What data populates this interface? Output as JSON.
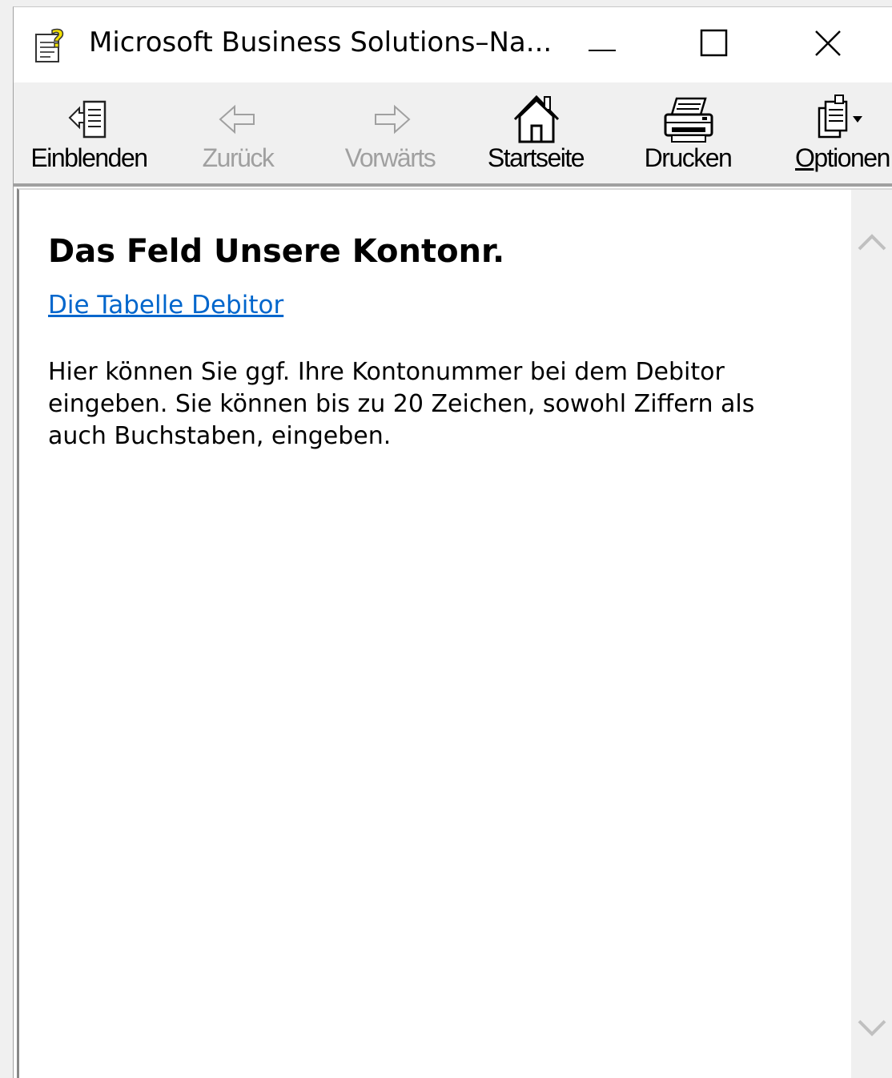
{
  "window": {
    "title": "Microsoft Business Solutions–Na..."
  },
  "toolbar": {
    "items": [
      {
        "label": "Einblenden",
        "icon": "show-pane-icon",
        "enabled": true
      },
      {
        "label": "Zurück",
        "icon": "back-arrow-icon",
        "enabled": false
      },
      {
        "label": "Vorwärts",
        "icon": "forward-arrow-icon",
        "enabled": false
      },
      {
        "label": "Startseite",
        "icon": "home-icon",
        "enabled": true
      },
      {
        "label": "Drucken",
        "icon": "printer-icon",
        "enabled": true
      },
      {
        "label": "Optionen",
        "icon": "options-icon",
        "enabled": true
      }
    ]
  },
  "content": {
    "heading": "Das Feld Unsere Kontonr.",
    "link": "Die Tabelle Debitor",
    "body": "Hier können Sie ggf. Ihre Kontonummer bei dem Debitor eingeben. Sie können bis zu 20 Zeichen, sowohl Ziffern als auch Buchstaben, eingeben."
  },
  "colors": {
    "link": "#0066cc",
    "toolbar_bg": "#f0f0f0",
    "disabled_text": "#a0a0a0"
  }
}
